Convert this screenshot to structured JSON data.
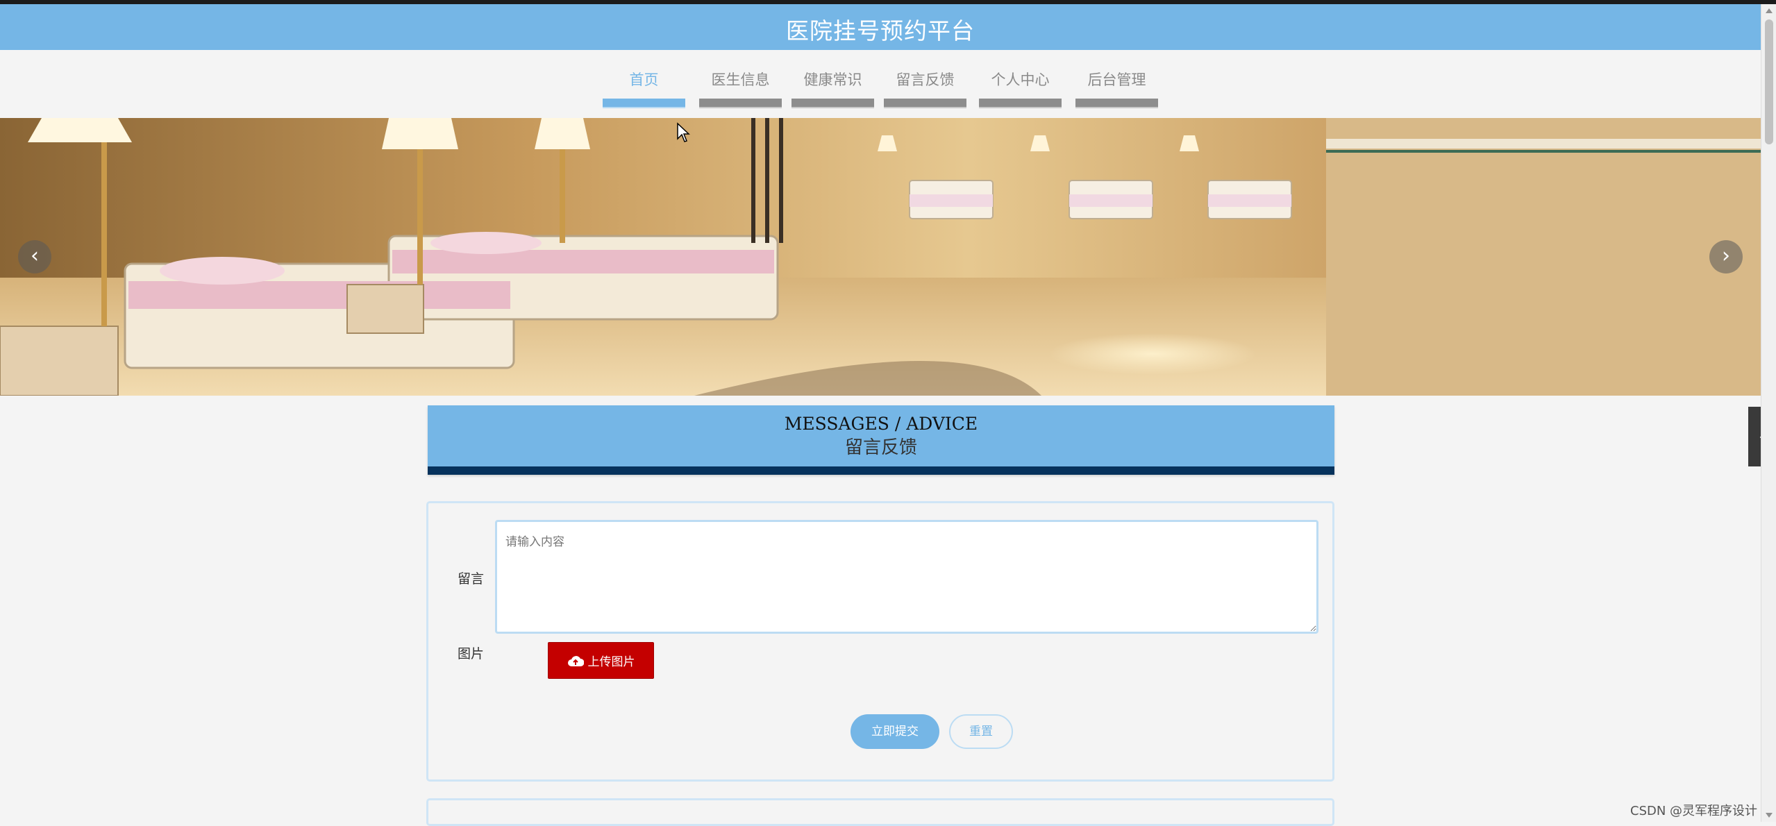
{
  "site": {
    "title": "医院挂号预约平台"
  },
  "nav": {
    "items": [
      {
        "label": "首页",
        "active": true
      },
      {
        "label": "医生信息",
        "active": false
      },
      {
        "label": "健康常识",
        "active": false
      },
      {
        "label": "留言反馈",
        "active": false
      },
      {
        "label": "个人中心",
        "active": false
      },
      {
        "label": "后台管理",
        "active": false
      }
    ]
  },
  "carousel": {
    "prev_icon": "chevron-left-icon",
    "next_icon": "chevron-right-icon"
  },
  "section": {
    "title_en": "MESSAGES / ADVICE",
    "title_cn": "留言反馈"
  },
  "form": {
    "message_label": "留言",
    "message_placeholder": "请输入内容",
    "message_value": "",
    "image_label": "图片",
    "upload_label": "上传图片",
    "upload_icon": "cloud-upload-icon",
    "submit_label": "立即提交",
    "reset_label": "重置"
  },
  "watermark": "CSDN @灵军程序设计",
  "colors": {
    "primary": "#75b6e6",
    "dark_bar": "#06325c",
    "upload": "#c40000",
    "background": "#f4f4f4"
  }
}
